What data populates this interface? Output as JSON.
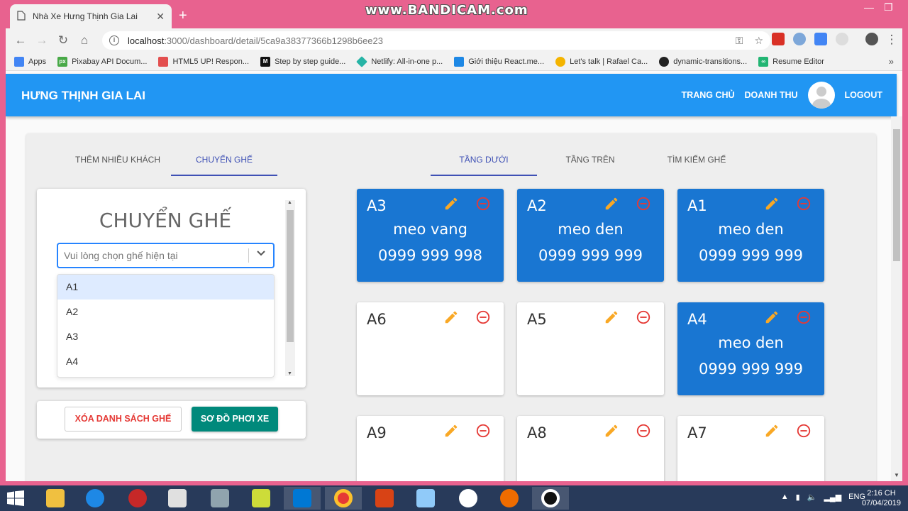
{
  "browser": {
    "tab_title": "Nhà Xe Hưng Thịnh Gia Lai",
    "new_tab": "+",
    "close_tab": "✕",
    "recorder_watermark": "www.BANDICAM.com",
    "url_host": "localhost",
    "url_path": ":3000/dashboard/detail/5ca9a38377366b1298b6ee23",
    "bookmarks": [
      {
        "label": "Apps",
        "color": "#4285f4"
      },
      {
        "label": "Pixabay API Docum...",
        "color": "#48a947"
      },
      {
        "label": "HTML5 UP! Respon...",
        "color": "#e34f4f"
      },
      {
        "label": "Step by step guide...",
        "color": "#111111"
      },
      {
        "label": "Netlify: All-in-one p...",
        "color": "#27b4a6"
      },
      {
        "label": "Giới thiệu React.me...",
        "color": "#1e88e5"
      },
      {
        "label": "Let's talk | Rafael Ca...",
        "color": "#f4b400"
      },
      {
        "label": "dynamic-transitions...",
        "color": "#222222"
      },
      {
        "label": "Resume Editor",
        "color": "#22b573"
      }
    ]
  },
  "app": {
    "brand": "HƯNG THỊNH GIA LAI",
    "nav": {
      "home": "TRANG CHỦ",
      "revenue": "DOANH THU",
      "logout": "LOGOUT"
    },
    "accent": "#2196f3",
    "left_tabs": [
      {
        "label": "THÊM NHIỀU KHÁCH",
        "active": false
      },
      {
        "label": "CHUYỂN GHẾ",
        "active": true
      }
    ],
    "right_tabs": [
      {
        "label": "TẦNG DƯỚI",
        "active": true
      },
      {
        "label": "TẦNG TRÊN",
        "active": false
      },
      {
        "label": "TÌM KIẾM GHẾ",
        "active": false
      }
    ],
    "transfer": {
      "title": "CHUYỂN GHẾ",
      "placeholder": "Vui lòng chọn ghế hiện tại",
      "options": [
        "A1",
        "A2",
        "A3",
        "A4"
      ],
      "focused_option": "A1"
    },
    "actions": {
      "clear": "XÓA DANH SÁCH GHẾ",
      "map": "SƠ ĐỒ PHƠI XE"
    },
    "seats": [
      {
        "code": "A3",
        "name": "meo vang",
        "phone": "0999 999 998",
        "occupied": true
      },
      {
        "code": "A2",
        "name": "meo den",
        "phone": "0999 999 999",
        "occupied": true
      },
      {
        "code": "A1",
        "name": "meo den",
        "phone": "0999 999 999",
        "occupied": true
      },
      {
        "code": "A6",
        "name": "",
        "phone": "",
        "occupied": false
      },
      {
        "code": "A5",
        "name": "",
        "phone": "",
        "occupied": false
      },
      {
        "code": "A4",
        "name": "meo den",
        "phone": "0999 999 999",
        "occupied": true
      },
      {
        "code": "A9",
        "name": "",
        "phone": "",
        "occupied": false
      },
      {
        "code": "A8",
        "name": "",
        "phone": "",
        "occupied": false
      },
      {
        "code": "A7",
        "name": "",
        "phone": "",
        "occupied": false
      }
    ]
  },
  "taskbar": {
    "language": "ENG",
    "time": "2:16 CH",
    "date": "07/04/2019"
  }
}
